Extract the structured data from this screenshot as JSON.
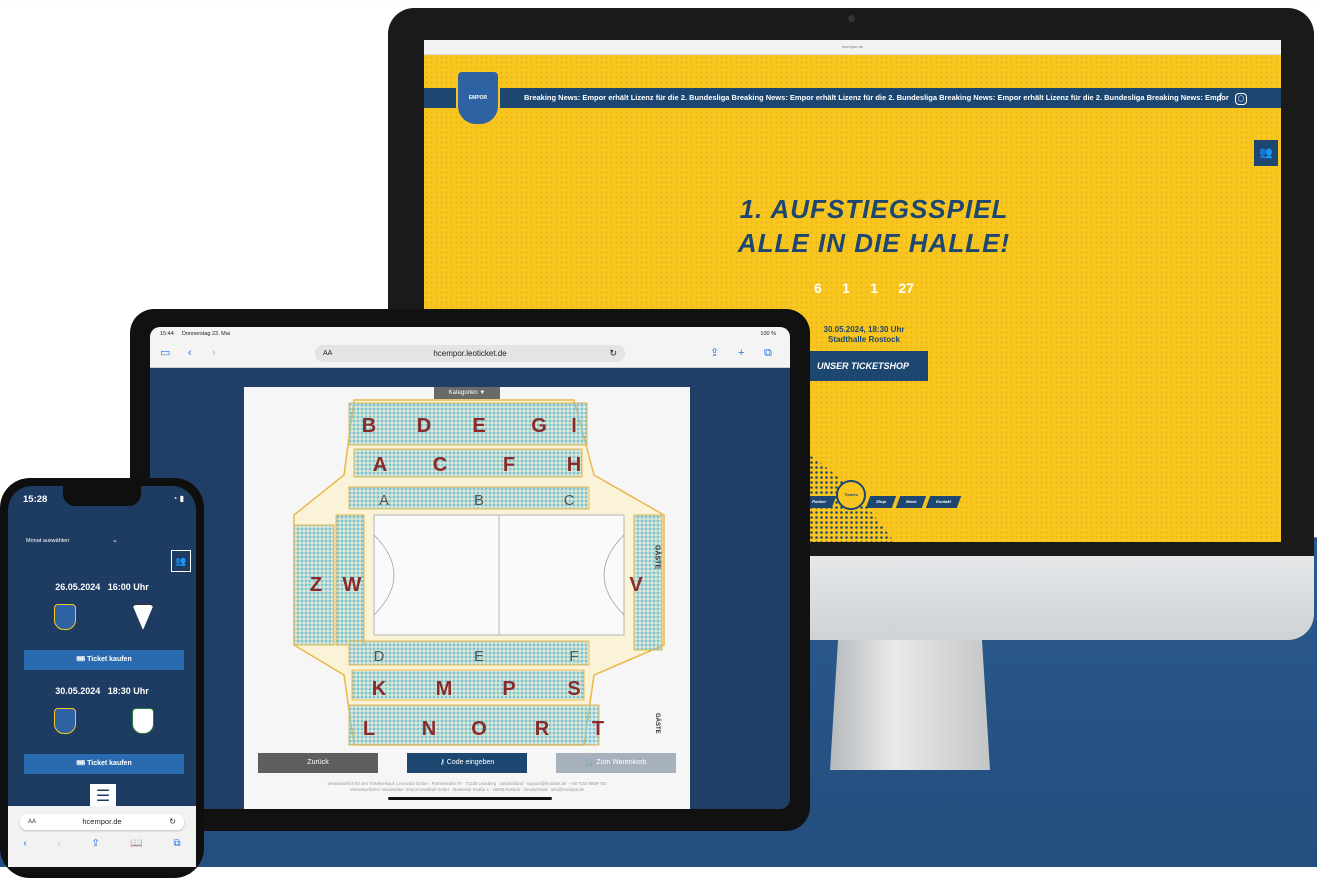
{
  "desktop": {
    "browser_url": "hcempor.de",
    "breaking_news_text": "Breaking News:   Empor erhält Lizenz für die 2. Bundesliga   Breaking News:   Empor erhält Lizenz für die 2. Bundesliga   Breaking News:   Empor erhält Lizenz für die 2. Bundesliga   Breaking News:   Empor",
    "logo_text": "EMPOR",
    "hero_line1": "1. AUFSTIEGSSPIEL",
    "hero_line2": "ALLE IN DIE HALLE!",
    "countdown": [
      "6",
      "1",
      "1",
      "27"
    ],
    "event_datetime": "30.05.2024, 18:30 Uhr",
    "event_venue": "Stadthalle Rostock",
    "shop_button": "UNSER TICKETSHOP",
    "ticket_circle": "Tickets",
    "nav": [
      "Partner",
      "Shop",
      "News",
      "Kontakt"
    ],
    "colors": {
      "yellow": "#f8c61e",
      "navy": "#1d4770"
    }
  },
  "tablet": {
    "status_time": "15:44",
    "status_date": "Donnerstag 23. Mai",
    "status_battery": "100 %",
    "url": "hcempor.leoticket.de",
    "url_aa": "AA",
    "category_button": "Kategorien ▼",
    "blocks_upper": [
      "B",
      "D",
      "E",
      "G",
      "I"
    ],
    "blocks_upper_mid": [
      "A",
      "C",
      "F",
      "H"
    ],
    "blocks_field_top": [
      "A",
      "B",
      "C"
    ],
    "blocks_left": [
      "Z",
      "W"
    ],
    "blocks_right": [
      "V"
    ],
    "guest_label": "GÄSTE",
    "blocks_field_bottom": [
      "D",
      "E",
      "F"
    ],
    "blocks_lower_mid": [
      "K",
      "M",
      "P",
      "S"
    ],
    "blocks_lower": [
      "L",
      "N",
      "O",
      "R",
      "T"
    ],
    "back_button": "Zurück",
    "code_button": "Code eingeben",
    "cart_button": "Zum Warenkorb",
    "footer_line1": "Verantwortlich für den Ticketverkauf: Leomedia GmbH · Römerstraße 97 · 71229 Leonberg · Deutschland · support@leoticket.de · +49 7152 9859-700",
    "footer_line2": "Verantwortlicher Veranstalter: Empor Handball GmbH · Markestor Straße 4 · 18069 Rostock · Deutschland · info@hcempor.de"
  },
  "phone": {
    "status_time": "15:28",
    "month_select": "Monat auswählen",
    "matches": [
      {
        "date": "26.05.2024",
        "time": "16:00 Uhr",
        "button": "Ticket kaufen"
      },
      {
        "date": "30.05.2024",
        "time": "18:30 Uhr",
        "button": "Ticket kaufen"
      }
    ],
    "url": "hcempor.de",
    "url_aa": "AA"
  }
}
